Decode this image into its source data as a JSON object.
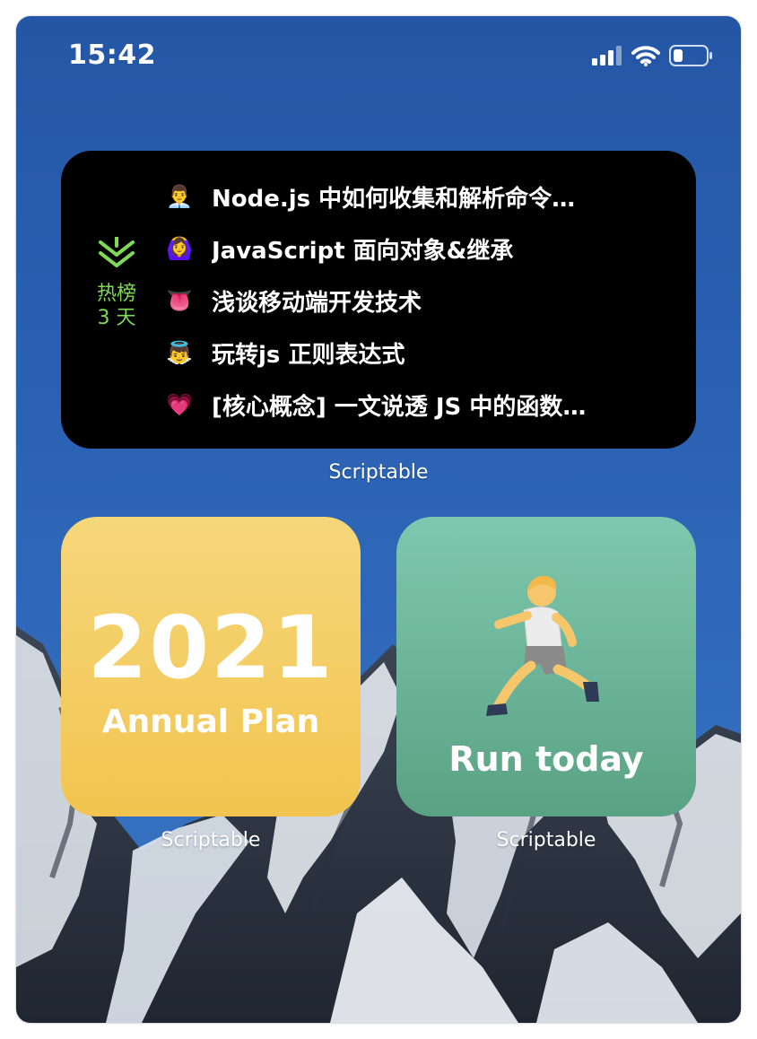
{
  "status_bar": {
    "time": "15:42"
  },
  "news_widget": {
    "badge": {
      "icon": "layered-chevron-icon",
      "line1": "热榜",
      "line2": "3 天",
      "color": "#7ed957"
    },
    "items": [
      {
        "emoji": "👨‍💼",
        "title": "Node.js 中如何收集和解析命令…"
      },
      {
        "emoji": "🙆‍♀️",
        "title": "JavaScript 面向对象&继承"
      },
      {
        "emoji": "👅",
        "title": "浅谈移动端开发技术"
      },
      {
        "emoji": "👼",
        "title": "玩转js 正则表达式"
      },
      {
        "emoji": "💗",
        "title": "[核心概念] 一文说透 JS 中的函数…"
      }
    ],
    "caption": "Scriptable"
  },
  "plan_widget": {
    "year": "2021",
    "label": "Annual Plan",
    "caption": "Scriptable"
  },
  "run_widget": {
    "icon": "runner-icon",
    "label": "Run today",
    "caption": "Scriptable"
  },
  "colors": {
    "sky": "#2456a5",
    "news_bg": "#000000",
    "plan_bg": "#f2c44f",
    "run_bg": "#6bb596"
  }
}
